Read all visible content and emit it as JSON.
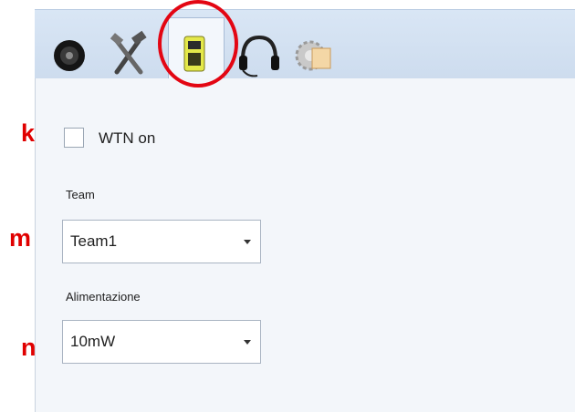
{
  "tabs": [
    {
      "icon": "disc-icon"
    },
    {
      "icon": "tools-icon"
    },
    {
      "icon": "radio-device-icon",
      "active": true
    },
    {
      "icon": "headset-icon"
    },
    {
      "icon": "settings-gear-icon"
    }
  ],
  "annotations": {
    "k": "k",
    "m": "m",
    "n": "n",
    "highlight_color": "#e30613"
  },
  "wtn": {
    "label": "WTN on",
    "checked": false
  },
  "team": {
    "label": "Team",
    "value": "Team1"
  },
  "power": {
    "label": "Alimentazione",
    "value": "10mW"
  }
}
